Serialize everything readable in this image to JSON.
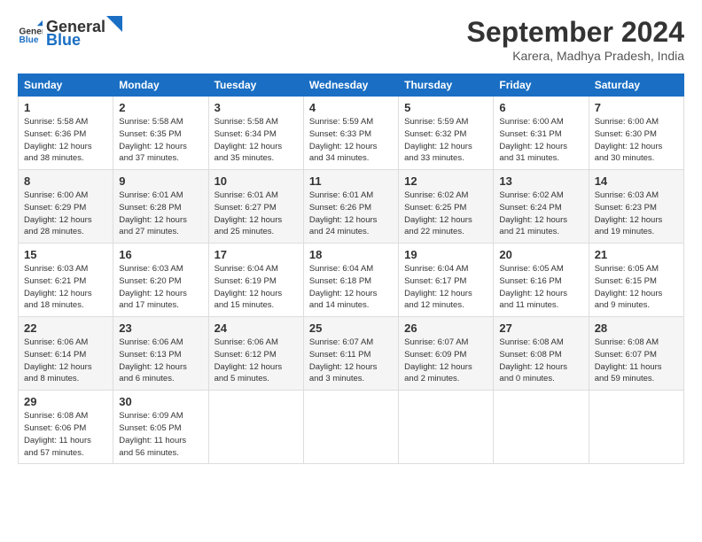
{
  "header": {
    "logo_general": "General",
    "logo_blue": "Blue",
    "title": "September 2024",
    "location": "Karera, Madhya Pradesh, India"
  },
  "weekdays": [
    "Sunday",
    "Monday",
    "Tuesday",
    "Wednesday",
    "Thursday",
    "Friday",
    "Saturday"
  ],
  "weeks": [
    [
      {
        "day": "1",
        "lines": [
          "Sunrise: 5:58 AM",
          "Sunset: 6:36 PM",
          "Daylight: 12 hours",
          "and 38 minutes."
        ]
      },
      {
        "day": "2",
        "lines": [
          "Sunrise: 5:58 AM",
          "Sunset: 6:35 PM",
          "Daylight: 12 hours",
          "and 37 minutes."
        ]
      },
      {
        "day": "3",
        "lines": [
          "Sunrise: 5:58 AM",
          "Sunset: 6:34 PM",
          "Daylight: 12 hours",
          "and 35 minutes."
        ]
      },
      {
        "day": "4",
        "lines": [
          "Sunrise: 5:59 AM",
          "Sunset: 6:33 PM",
          "Daylight: 12 hours",
          "and 34 minutes."
        ]
      },
      {
        "day": "5",
        "lines": [
          "Sunrise: 5:59 AM",
          "Sunset: 6:32 PM",
          "Daylight: 12 hours",
          "and 33 minutes."
        ]
      },
      {
        "day": "6",
        "lines": [
          "Sunrise: 6:00 AM",
          "Sunset: 6:31 PM",
          "Daylight: 12 hours",
          "and 31 minutes."
        ]
      },
      {
        "day": "7",
        "lines": [
          "Sunrise: 6:00 AM",
          "Sunset: 6:30 PM",
          "Daylight: 12 hours",
          "and 30 minutes."
        ]
      }
    ],
    [
      {
        "day": "8",
        "lines": [
          "Sunrise: 6:00 AM",
          "Sunset: 6:29 PM",
          "Daylight: 12 hours",
          "and 28 minutes."
        ]
      },
      {
        "day": "9",
        "lines": [
          "Sunrise: 6:01 AM",
          "Sunset: 6:28 PM",
          "Daylight: 12 hours",
          "and 27 minutes."
        ]
      },
      {
        "day": "10",
        "lines": [
          "Sunrise: 6:01 AM",
          "Sunset: 6:27 PM",
          "Daylight: 12 hours",
          "and 25 minutes."
        ]
      },
      {
        "day": "11",
        "lines": [
          "Sunrise: 6:01 AM",
          "Sunset: 6:26 PM",
          "Daylight: 12 hours",
          "and 24 minutes."
        ]
      },
      {
        "day": "12",
        "lines": [
          "Sunrise: 6:02 AM",
          "Sunset: 6:25 PM",
          "Daylight: 12 hours",
          "and 22 minutes."
        ]
      },
      {
        "day": "13",
        "lines": [
          "Sunrise: 6:02 AM",
          "Sunset: 6:24 PM",
          "Daylight: 12 hours",
          "and 21 minutes."
        ]
      },
      {
        "day": "14",
        "lines": [
          "Sunrise: 6:03 AM",
          "Sunset: 6:23 PM",
          "Daylight: 12 hours",
          "and 19 minutes."
        ]
      }
    ],
    [
      {
        "day": "15",
        "lines": [
          "Sunrise: 6:03 AM",
          "Sunset: 6:21 PM",
          "Daylight: 12 hours",
          "and 18 minutes."
        ]
      },
      {
        "day": "16",
        "lines": [
          "Sunrise: 6:03 AM",
          "Sunset: 6:20 PM",
          "Daylight: 12 hours",
          "and 17 minutes."
        ]
      },
      {
        "day": "17",
        "lines": [
          "Sunrise: 6:04 AM",
          "Sunset: 6:19 PM",
          "Daylight: 12 hours",
          "and 15 minutes."
        ]
      },
      {
        "day": "18",
        "lines": [
          "Sunrise: 6:04 AM",
          "Sunset: 6:18 PM",
          "Daylight: 12 hours",
          "and 14 minutes."
        ]
      },
      {
        "day": "19",
        "lines": [
          "Sunrise: 6:04 AM",
          "Sunset: 6:17 PM",
          "Daylight: 12 hours",
          "and 12 minutes."
        ]
      },
      {
        "day": "20",
        "lines": [
          "Sunrise: 6:05 AM",
          "Sunset: 6:16 PM",
          "Daylight: 12 hours",
          "and 11 minutes."
        ]
      },
      {
        "day": "21",
        "lines": [
          "Sunrise: 6:05 AM",
          "Sunset: 6:15 PM",
          "Daylight: 12 hours",
          "and 9 minutes."
        ]
      }
    ],
    [
      {
        "day": "22",
        "lines": [
          "Sunrise: 6:06 AM",
          "Sunset: 6:14 PM",
          "Daylight: 12 hours",
          "and 8 minutes."
        ]
      },
      {
        "day": "23",
        "lines": [
          "Sunrise: 6:06 AM",
          "Sunset: 6:13 PM",
          "Daylight: 12 hours",
          "and 6 minutes."
        ]
      },
      {
        "day": "24",
        "lines": [
          "Sunrise: 6:06 AM",
          "Sunset: 6:12 PM",
          "Daylight: 12 hours",
          "and 5 minutes."
        ]
      },
      {
        "day": "25",
        "lines": [
          "Sunrise: 6:07 AM",
          "Sunset: 6:11 PM",
          "Daylight: 12 hours",
          "and 3 minutes."
        ]
      },
      {
        "day": "26",
        "lines": [
          "Sunrise: 6:07 AM",
          "Sunset: 6:09 PM",
          "Daylight: 12 hours",
          "and 2 minutes."
        ]
      },
      {
        "day": "27",
        "lines": [
          "Sunrise: 6:08 AM",
          "Sunset: 6:08 PM",
          "Daylight: 12 hours",
          "and 0 minutes."
        ]
      },
      {
        "day": "28",
        "lines": [
          "Sunrise: 6:08 AM",
          "Sunset: 6:07 PM",
          "Daylight: 11 hours",
          "and 59 minutes."
        ]
      }
    ],
    [
      {
        "day": "29",
        "lines": [
          "Sunrise: 6:08 AM",
          "Sunset: 6:06 PM",
          "Daylight: 11 hours",
          "and 57 minutes."
        ]
      },
      {
        "day": "30",
        "lines": [
          "Sunrise: 6:09 AM",
          "Sunset: 6:05 PM",
          "Daylight: 11 hours",
          "and 56 minutes."
        ]
      },
      {
        "day": "",
        "lines": []
      },
      {
        "day": "",
        "lines": []
      },
      {
        "day": "",
        "lines": []
      },
      {
        "day": "",
        "lines": []
      },
      {
        "day": "",
        "lines": []
      }
    ]
  ]
}
